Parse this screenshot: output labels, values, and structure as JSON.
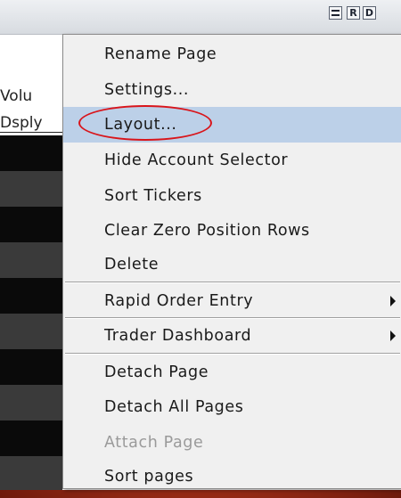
{
  "window": {
    "buttons": [
      {
        "name": "window-equal-icon",
        "label": ""
      },
      {
        "name": "r-button",
        "label": "R"
      },
      {
        "name": "d-button",
        "label": "D"
      }
    ]
  },
  "background": {
    "column_header_1": "Volu",
    "column_header_2": "Dsply"
  },
  "menu": {
    "items": [
      {
        "label": "Rename Page"
      },
      {
        "label": "Settings..."
      },
      {
        "label": "Layout..."
      },
      {
        "label": "Hide Account Selector"
      },
      {
        "label": "Sort Tickers"
      },
      {
        "label": "Clear Zero Position Rows"
      },
      {
        "label": "Delete"
      },
      {
        "label": "Rapid Order Entry"
      },
      {
        "label": "Trader Dashboard"
      },
      {
        "label": "Detach Page"
      },
      {
        "label": "Detach All Pages"
      },
      {
        "label": "Attach Page"
      },
      {
        "label": "Sort pages"
      }
    ],
    "highlighted_item": "Layout...",
    "disabled_item": "Attach Page"
  },
  "colors": {
    "highlight": "#bcd0e8",
    "annotation_circle": "#d9151b",
    "stripe_dark": "#0a0a0a",
    "stripe_gray": "#3a3a3a"
  }
}
